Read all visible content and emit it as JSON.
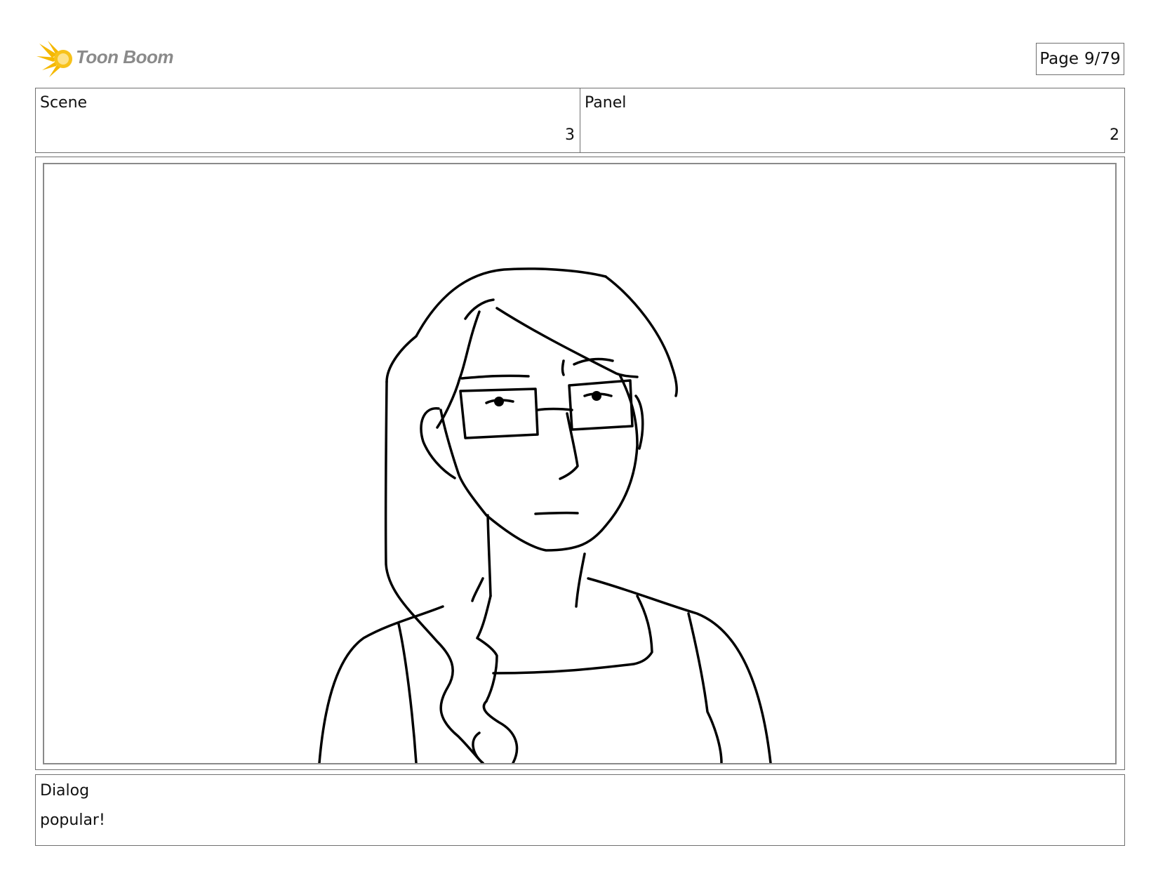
{
  "logo": {
    "text": "Toon Boom",
    "icon": "starburst-logo-icon",
    "accent_color": "#f5b800"
  },
  "page_indicator": {
    "label": "Page",
    "value": "9/79"
  },
  "header": {
    "scene": {
      "label": "Scene",
      "value": "3"
    },
    "panel": {
      "label": "Panel",
      "value": "2"
    }
  },
  "panel_image": {
    "icon": "character-sketch"
  },
  "dialog": {
    "label": "Dialog",
    "text": "popular!"
  }
}
